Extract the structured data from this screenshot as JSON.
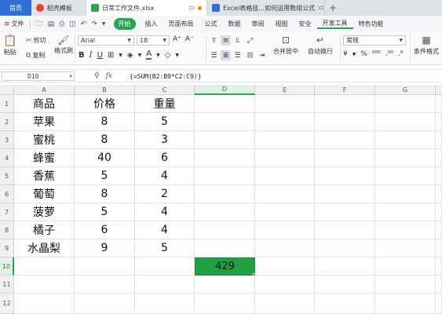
{
  "tabs": {
    "home": "首页",
    "items": [
      {
        "label": "稻壳模板",
        "icon_color": "#e0432a",
        "active": false
      },
      {
        "label": "日常工作文件.xlsx",
        "icon_color": "#2aa44f",
        "active": true
      },
      {
        "label": "Excel表格技…如何运用数组公式",
        "icon_color": "#2f6fd6",
        "active": false
      }
    ],
    "add": "+"
  },
  "menu": {
    "file": "文件",
    "start": "开始",
    "items": [
      "插入",
      "页面布局",
      "公式",
      "数据",
      "审阅",
      "视图",
      "安全",
      "开发工具",
      "特色功能"
    ]
  },
  "ribbon": {
    "paste": "粘贴",
    "cut": "剪切",
    "copy": "复制",
    "format_painter": "格式刷",
    "font_name": "Arial",
    "font_size": "18",
    "merge_center": "合并居中",
    "wrap_text": "自动换行",
    "number_format": "常规",
    "conditional_format": "条件格式"
  },
  "formula_bar": {
    "cell_ref": "D10",
    "formula": "{=SUM(B2:B9*C2:C9)}"
  },
  "columns": [
    "A",
    "B",
    "C",
    "D",
    "E",
    "F",
    "G"
  ],
  "rows": [
    "1",
    "2",
    "3",
    "4",
    "5",
    "6",
    "7",
    "8",
    "9",
    "10",
    "11",
    "12"
  ],
  "sheet": {
    "headers": [
      "商品",
      "价格",
      "重量"
    ],
    "data": [
      [
        "苹果",
        "8",
        "5"
      ],
      [
        "蜜桃",
        "8",
        "3"
      ],
      [
        "蜂蜜",
        "40",
        "6"
      ],
      [
        "香蕉",
        "5",
        "4"
      ],
      [
        "葡萄",
        "8",
        "2"
      ],
      [
        "菠萝",
        "5",
        "4"
      ],
      [
        "橘子",
        "6",
        "4"
      ],
      [
        "水晶梨",
        "9",
        "5"
      ]
    ],
    "result": "429"
  },
  "colors": {
    "accent": "#2aa44f",
    "result_fill": "#1fa045",
    "home_tab": "#2f6fd6"
  }
}
